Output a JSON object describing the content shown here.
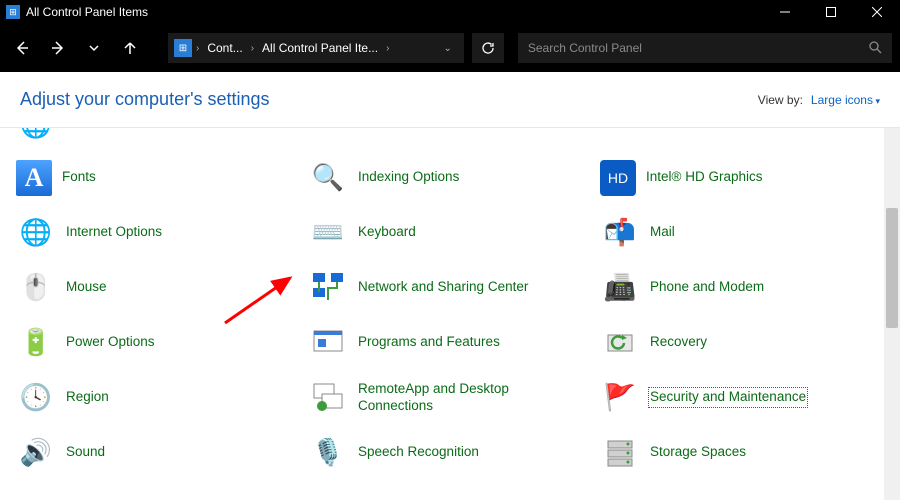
{
  "window": {
    "title": "All Control Panel Items"
  },
  "breadcrumb": {
    "part1": "Cont...",
    "part2": "All Control Panel Ite..."
  },
  "search": {
    "placeholder": "Search Control Panel"
  },
  "header": {
    "adjust_text": "Adjust your computer's settings",
    "viewby_label": "View by:",
    "viewby_value": "Large icons"
  },
  "items": {
    "fonts": "Fonts",
    "indexing": "Indexing Options",
    "intel": "Intel® HD Graphics",
    "internet": "Internet Options",
    "keyboard": "Keyboard",
    "mail": "Mail",
    "mouse": "Mouse",
    "network": "Network and Sharing Center",
    "phone": "Phone and Modem",
    "power": "Power Options",
    "programs": "Programs and Features",
    "recovery": "Recovery",
    "region": "Region",
    "remoteapp": "RemoteApp and Desktop Connections",
    "security": "Security and Maintenance",
    "sound": "Sound",
    "speech": "Speech Recognition",
    "storage": "Storage Spaces"
  }
}
